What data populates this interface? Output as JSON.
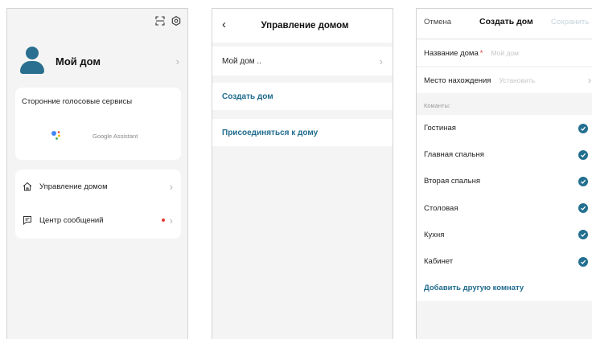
{
  "colors": {
    "accent": "#1f6b8e",
    "check": "#236f8f",
    "required": "#e53935",
    "background": "#f4f4f4"
  },
  "screen1": {
    "icons": [
      "scan-icon",
      "settings-icon"
    ],
    "home_name": "Мой дом",
    "voice_services_title": "Сторонние голосовые сервисы",
    "google_assistant_label": "Google Assistant",
    "menu": [
      {
        "label": "Управление домом",
        "icon": "home-icon"
      },
      {
        "label": "Центр сообщений",
        "icon": "message-icon",
        "has_unread_dot": true
      }
    ]
  },
  "screen2": {
    "title": "Управление домом",
    "home_item": "Мой дом ..",
    "create_home": "Создать дом",
    "join_home": "Присоединяться к дому"
  },
  "screen3": {
    "cancel": "Отмена",
    "title": "Создать дом",
    "save": "Сохранить",
    "name_label": "Название дома",
    "name_placeholder": "Мой дом",
    "location_label": "Место нахождения",
    "location_placeholder": "Установить",
    "rooms_header": "Команты:",
    "rooms": [
      {
        "label": "Гостиная",
        "checked": true
      },
      {
        "label": "Главная спальня",
        "checked": true
      },
      {
        "label": "Вторая спальня",
        "checked": true
      },
      {
        "label": "Столовая",
        "checked": true
      },
      {
        "label": "Кухня",
        "checked": true
      },
      {
        "label": "Кабинет",
        "checked": true
      }
    ],
    "add_room": "Добавить другую комнату"
  }
}
